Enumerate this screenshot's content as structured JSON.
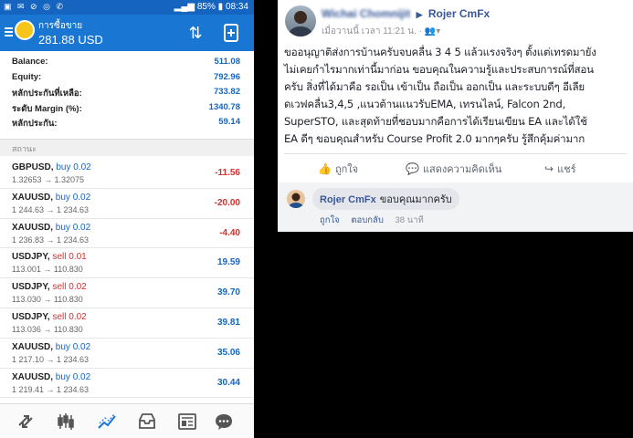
{
  "phone": {
    "status": {
      "battery": "85%",
      "time": "08:34"
    },
    "appbar": {
      "title": "การซื้อขาย",
      "total": "281.88 USD"
    },
    "summary": [
      {
        "label": "Balance:",
        "value": "511.08"
      },
      {
        "label": "Equity:",
        "value": "792.96"
      },
      {
        "label": "หลักประกันที่เหลือ:",
        "value": "733.82"
      },
      {
        "label": "ระดับ Margin (%):",
        "value": "1340.78"
      },
      {
        "label": "หลักประกัน:",
        "value": "59.14"
      }
    ],
    "section_label": "สถานะ",
    "positions": [
      {
        "symbol": "GBPUSD,",
        "side": "buy 0.02",
        "prices": "1.32653 → 1.32075",
        "profit": "-11.56",
        "dir": "buy",
        "neg": true
      },
      {
        "symbol": "XAUUSD,",
        "side": "buy 0.02",
        "prices": "1 244.63 → 1 234.63",
        "profit": "-20.00",
        "dir": "buy",
        "neg": true
      },
      {
        "symbol": "XAUUSD,",
        "side": "buy 0.02",
        "prices": "1 236.83 → 1 234.63",
        "profit": "-4.40",
        "dir": "buy",
        "neg": true
      },
      {
        "symbol": "USDJPY,",
        "side": "sell 0.01",
        "prices": "113.001 → 110.830",
        "profit": "19.59",
        "dir": "sell",
        "neg": false
      },
      {
        "symbol": "USDJPY,",
        "side": "sell 0.02",
        "prices": "113.030 → 110.830",
        "profit": "39.70",
        "dir": "sell",
        "neg": false
      },
      {
        "symbol": "USDJPY,",
        "side": "sell 0.02",
        "prices": "113.036 → 110.830",
        "profit": "39.81",
        "dir": "sell",
        "neg": false
      },
      {
        "symbol": "XAUUSD,",
        "side": "buy 0.02",
        "prices": "1 217.10 → 1 234.63",
        "profit": "35.06",
        "dir": "buy",
        "neg": false
      },
      {
        "symbol": "XAUUSD,",
        "side": "buy 0.02",
        "prices": "1 219.41 → 1 234.63",
        "profit": "30.44",
        "dir": "buy",
        "neg": false
      }
    ],
    "tabs": [
      "quotes-icon",
      "chart-icon",
      "trade-icon",
      "history-icon",
      "news-icon",
      "chat-icon"
    ]
  },
  "post": {
    "author": "Wichai Chomnijit",
    "target": "Rojer CmFx",
    "meta": "เมื่อวานนี้ เวลา 11:21 น. ·",
    "body_lines": [
      "ขออนุญาติส่งการบ้านครับจบคลื่น 3 4 5 แล้วแรงจริงๆ ตั้งแต่เทรดมายัง",
      "ไม่เคยกำไรมากเท่านี้มาก่อน ขอบคุณในความรู้และประสบการณ์ที่สอน",
      "ครับ สิ่งที่ได้มาคือ รอเป็น เข้าเป็น ถือเป็น ออกเป็น และระบบดีๆ อีเลีย",
      "ดเวฟคลื่น3,4,5 ,แนวต้านแนวรับEMA, เทรนไลน์, Falcon 2nd,",
      "SuperSTO, และสุดท้ายที่ชอบมากคือการได้เรียนเขียน EA และได้ใช้",
      "EA ดีๆ ขอบคุณสำหรับ Course Profit 2.0 มากๆครับ รู้สึกคุ้มค่ามาก"
    ],
    "actions": {
      "like": "ถูกใจ",
      "comment": "แสดงความคิดเห็น",
      "share": "แชร์"
    },
    "reply": {
      "author": "Rojer CmFx",
      "text": "ขอบคุณมากครับ",
      "like": "ถูกใจ",
      "reply_link": "ตอบกลับ",
      "time": "38 นาที"
    }
  }
}
